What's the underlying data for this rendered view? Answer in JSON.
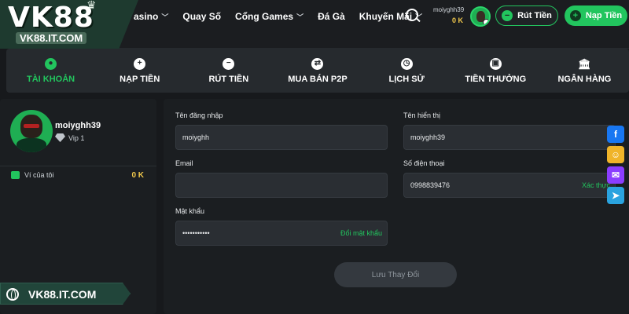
{
  "brand": {
    "logo": "VK88",
    "url_badge": "VK88.IT.COM",
    "footer": "VK88.IT.COM"
  },
  "nav": {
    "items": [
      {
        "label": "asino",
        "dropdown": true
      },
      {
        "label": "Quay Số",
        "dropdown": false
      },
      {
        "label": "Cổng Games",
        "dropdown": true
      },
      {
        "label": "Đá Gà",
        "dropdown": false
      },
      {
        "label": "Khuyến Mãi",
        "dropdown": true
      }
    ]
  },
  "user": {
    "username": "moiyghh39",
    "balance": "0 K",
    "vip": "Vip 1",
    "wallet_label": "Ví của tôi",
    "wallet_value": "0 K"
  },
  "header_buttons": {
    "withdraw": "Rút Tiền",
    "deposit": "Nạp Tiền"
  },
  "tabs": [
    {
      "label": "TÀI KHOẢN",
      "icon": "person-icon",
      "glyph": "●",
      "active": true
    },
    {
      "label": "NẠP TIỀN",
      "icon": "plus-circle-icon",
      "glyph": "+",
      "active": false
    },
    {
      "label": "RÚT TIỀN",
      "icon": "minus-circle-icon",
      "glyph": "−",
      "active": false
    },
    {
      "label": "MUA BÁN P2P",
      "icon": "exchange-icon",
      "glyph": "⇄",
      "active": false
    },
    {
      "label": "LỊCH SỬ",
      "icon": "clock-icon",
      "glyph": "◷",
      "active": false
    },
    {
      "label": "TIỀN THƯỞNG",
      "icon": "gift-icon",
      "glyph": "▣",
      "active": false
    },
    {
      "label": "NGÂN HÀNG",
      "icon": "bank-icon",
      "glyph": "🏛",
      "active": false
    }
  ],
  "form": {
    "login_label": "Tên đăng nhập",
    "login_value": "moiyghh",
    "display_label": "Tên hiển thị",
    "display_value": "moiyghh39",
    "email_label": "Email",
    "email_value": "",
    "phone_label": "Số điện thoại",
    "phone_value": "0998839476",
    "phone_action": "Xác thực",
    "password_label": "Mật khẩu",
    "password_value": "•••••••••••",
    "password_action": "Đổi mật khẩu",
    "save_label": "Lưu Thay Đổi"
  },
  "social": [
    "facebook-icon",
    "group-icon",
    "messenger-icon",
    "telegram-icon"
  ],
  "colors": {
    "accent": "#22c55e",
    "gold": "#f2c94c",
    "bg": "#17191c"
  }
}
